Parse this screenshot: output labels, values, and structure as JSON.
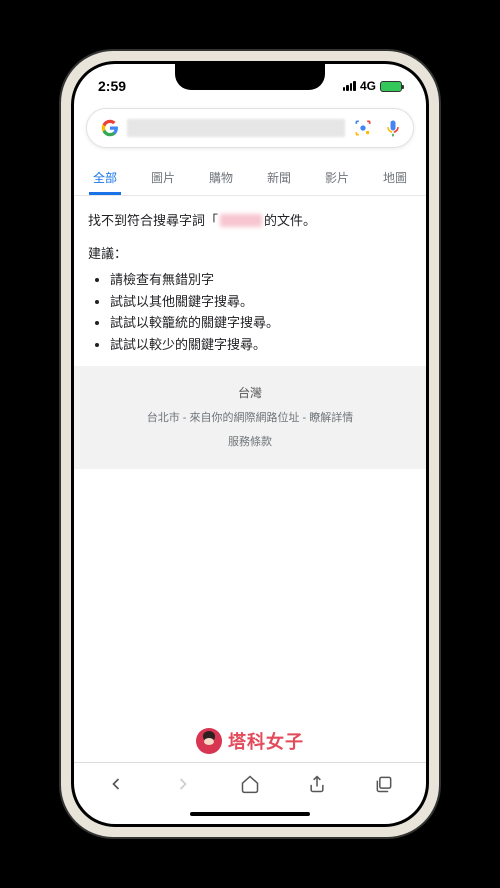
{
  "status": {
    "time": "2:59",
    "network": "4G"
  },
  "search": {
    "query": ""
  },
  "tabs": [
    {
      "label": "全部",
      "active": true
    },
    {
      "label": "圖片",
      "active": false
    },
    {
      "label": "購物",
      "active": false
    },
    {
      "label": "新聞",
      "active": false
    },
    {
      "label": "影片",
      "active": false
    },
    {
      "label": "地圖",
      "active": false
    }
  ],
  "results": {
    "no_results_prefix": "找不到符合搜尋字詞「",
    "no_results_suffix": "的文件。",
    "suggestions_title": "建議：",
    "suggestions": [
      "請檢查有無錯別字",
      "試試以其他關鍵字搜尋。",
      "試試以較籠統的關鍵字搜尋。",
      "試試以較少的關鍵字搜尋。"
    ]
  },
  "footer": {
    "country": "台灣",
    "location": "台北市 - 來自你的網際網路位址 - 瞭解詳情",
    "terms": "服務條款"
  },
  "watermark": {
    "text": "塔科女子"
  }
}
